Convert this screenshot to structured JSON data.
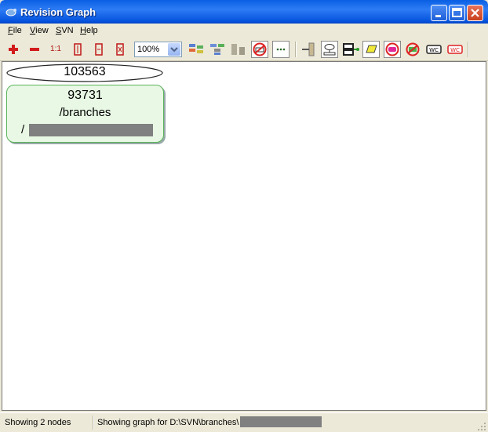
{
  "window": {
    "title": "Revision Graph"
  },
  "menu": [
    {
      "key": "F",
      "rest": "ile"
    },
    {
      "key": "V",
      "rest": "iew"
    },
    {
      "key": "S",
      "rest": "VN"
    },
    {
      "key": "H",
      "rest": "elp"
    }
  ],
  "toolbar": {
    "zoom_in_label": "+",
    "zoom_out_label": "−",
    "zoom_100_label": "1:1",
    "zoom_value": "100%"
  },
  "graph": {
    "head_node": {
      "revision": "103563"
    },
    "branch_node": {
      "revision": "93731",
      "path": "/branches",
      "subpath_prefix": "/"
    }
  },
  "status": {
    "nodes": "Showing 2 nodes",
    "path": "Showing graph for D:\\SVN\\branches\\"
  },
  "colors": {
    "title_bar": "#0A5FE3",
    "node_fill": "#E8F8E4",
    "node_border": "#5BB35B",
    "redaction": "#808080"
  }
}
